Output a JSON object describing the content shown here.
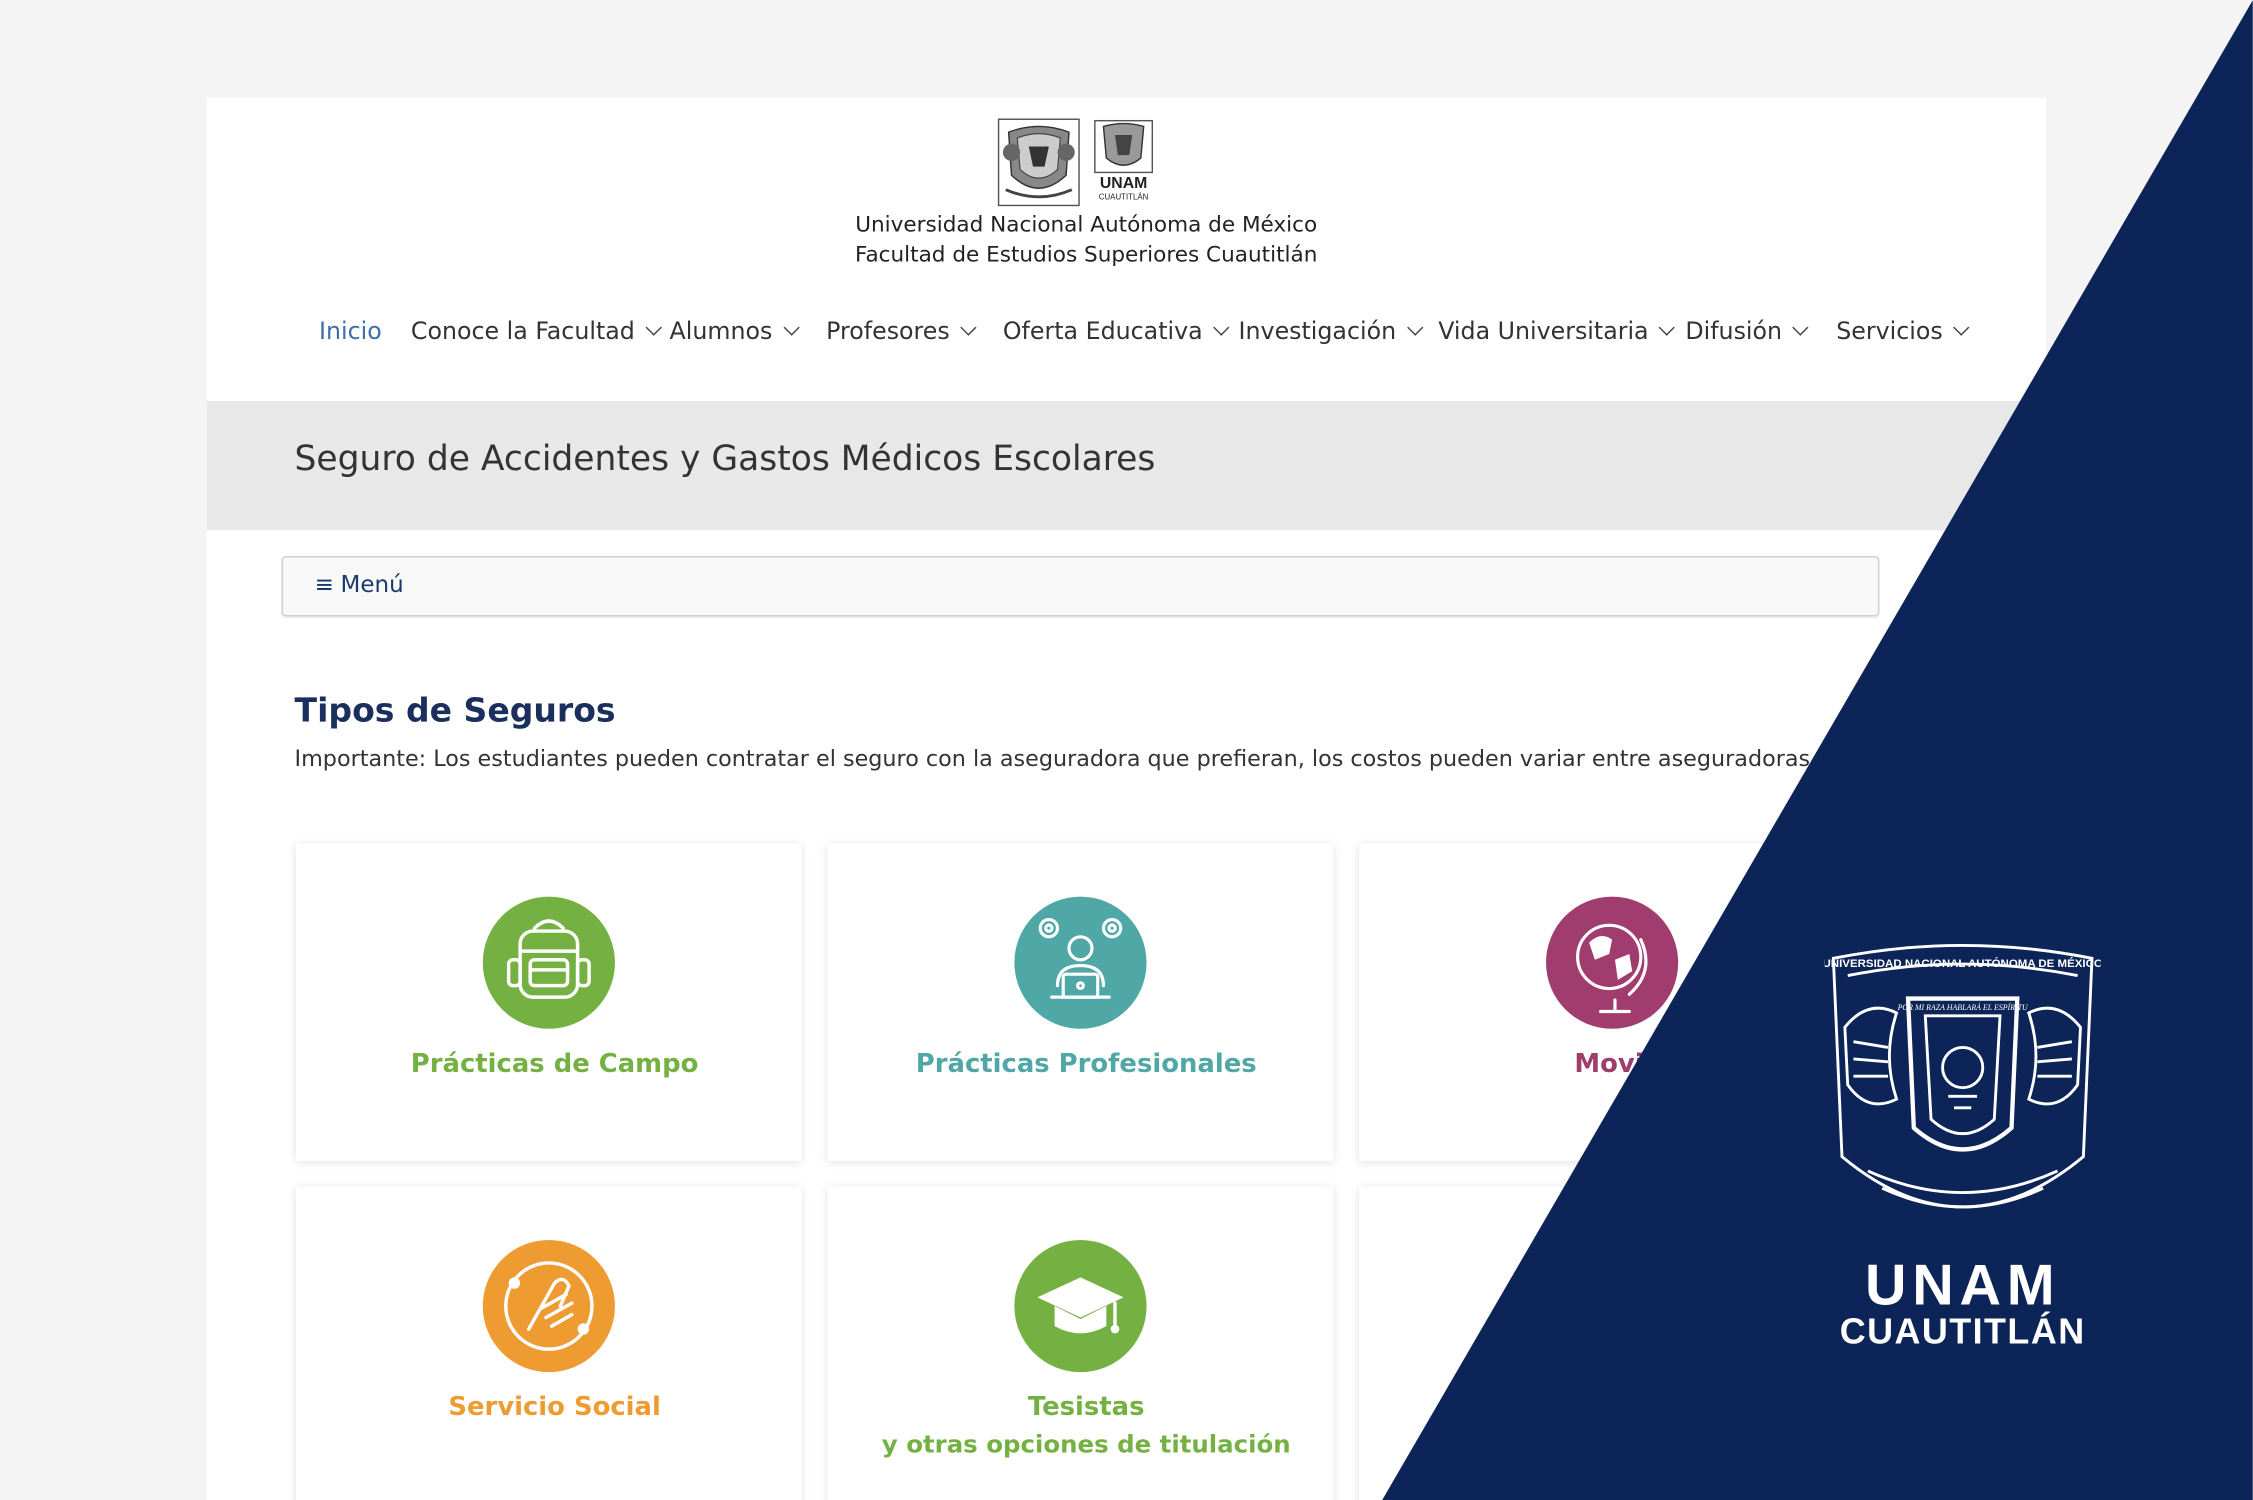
{
  "header": {
    "university": "Universidad Nacional Autónoma de México",
    "faculty": "Facultad de Estudios Superiores Cuautitlán",
    "fes_logo_text": [
      "UNAM",
      "CUAUTITLÁN"
    ]
  },
  "nav": {
    "items": [
      {
        "label": "Inicio",
        "active": true
      },
      {
        "label": "Conoce la Facultad",
        "dropdown": true
      },
      {
        "label": "Alumnos",
        "dropdown": true
      },
      {
        "label": "Profesores",
        "dropdown": true
      },
      {
        "label": "Oferta Educativa",
        "dropdown": true
      },
      {
        "label": "Investigación",
        "dropdown": true
      },
      {
        "label": "Vida Universitaria",
        "dropdown": true
      },
      {
        "label": "Difusión",
        "dropdown": true
      },
      {
        "label": "Servicios",
        "dropdown": true
      }
    ]
  },
  "page": {
    "title": "Seguro de Accidentes y Gastos Médicos Escolares",
    "menu_icon": "≡",
    "menu_label": "Menú",
    "section_title": "Tipos de Seguros",
    "section_desc": "Importante: Los estudiantes pueden contratar el seguro con la aseguradora que prefieran, los costos pueden variar entre aseguradoras."
  },
  "cards": [
    {
      "title": "Prácticas de Campo",
      "icon": "backpack-icon",
      "color": "#74b142"
    },
    {
      "title": "Prácticas Profesionales",
      "icon": "professional-laptop-icon",
      "color": "#4fa8a5"
    },
    {
      "title": "Movili",
      "icon": "globe-icon",
      "color": "#a03c6e"
    },
    {
      "title": "Servicio Social",
      "icon": "helping-hand-icon",
      "color": "#ee9b32"
    },
    {
      "title": "Tesistas",
      "subtitle": "y otras opciones de titulación",
      "icon": "graduation-cap-icon",
      "color": "#74b142"
    }
  ],
  "brand": {
    "emblem_text": [
      "UNIVERSIDAD NACIONAL AUTÓNOMA DE MÉXICO",
      "POR MI RAZA HABLARÁ EL ESPÍRITU"
    ],
    "line1": "UNAM",
    "line2": "CUAUTITLÁN",
    "background": "#0c2457"
  }
}
